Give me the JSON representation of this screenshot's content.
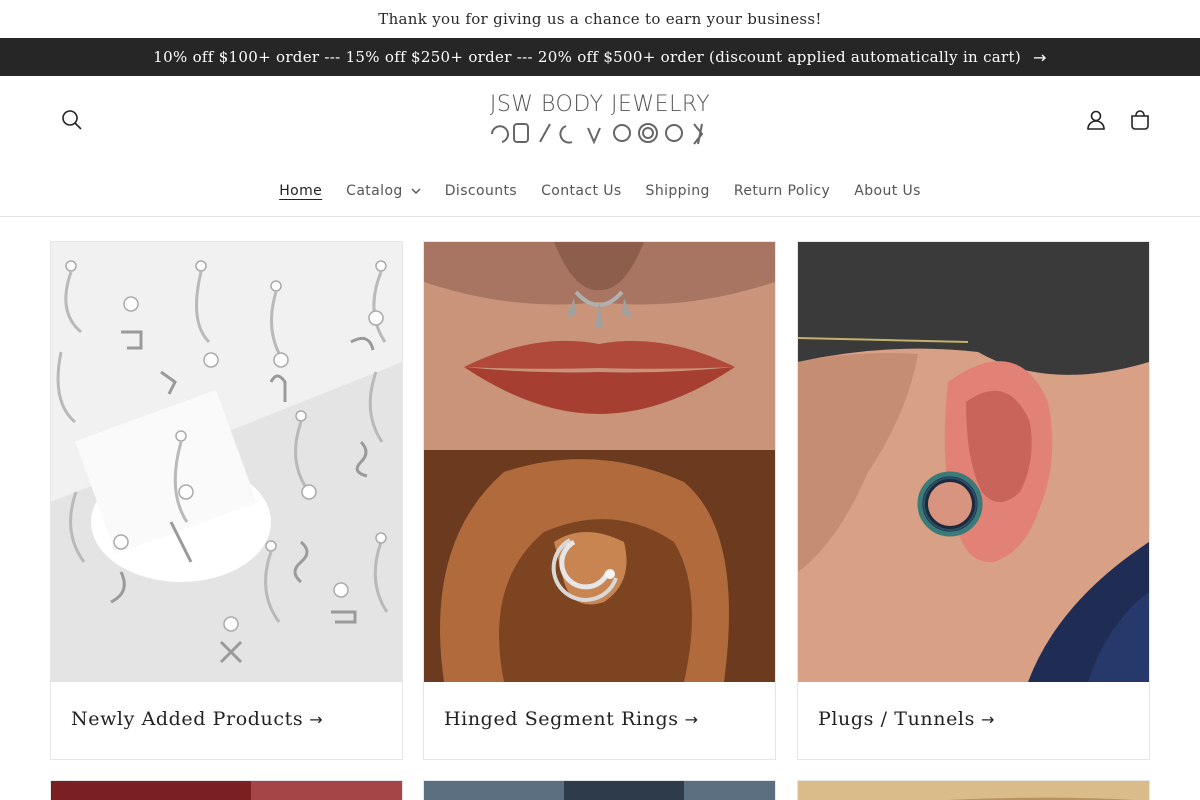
{
  "announcement": {
    "message": "Thank you for giving us a chance to earn your business!",
    "promo": "10% off $100+ order --- 15% off $250+ order --- 20% off $500+ order (discount applied automatically in cart)",
    "promo_arrow": "→"
  },
  "header": {
    "logo_text": "JSW BODY JEWELRY",
    "search_icon": "search-icon",
    "account_icon": "account-icon",
    "cart_icon": "cart-icon"
  },
  "nav": {
    "items": [
      {
        "label": "Home"
      },
      {
        "label": "Catalog"
      },
      {
        "label": "Discounts"
      },
      {
        "label": "Contact Us"
      },
      {
        "label": "Shipping"
      },
      {
        "label": "Return Policy"
      },
      {
        "label": "About Us"
      }
    ]
  },
  "collections": [
    {
      "title": "Newly Added Products",
      "arrow": "→"
    },
    {
      "title": "Hinged Segment Rings",
      "arrow": "→"
    },
    {
      "title": "Plugs / Tunnels",
      "arrow": "→"
    }
  ],
  "colors": {
    "promo_bar_bg": "#262626",
    "text": "#222222",
    "nav_text": "#555555"
  }
}
